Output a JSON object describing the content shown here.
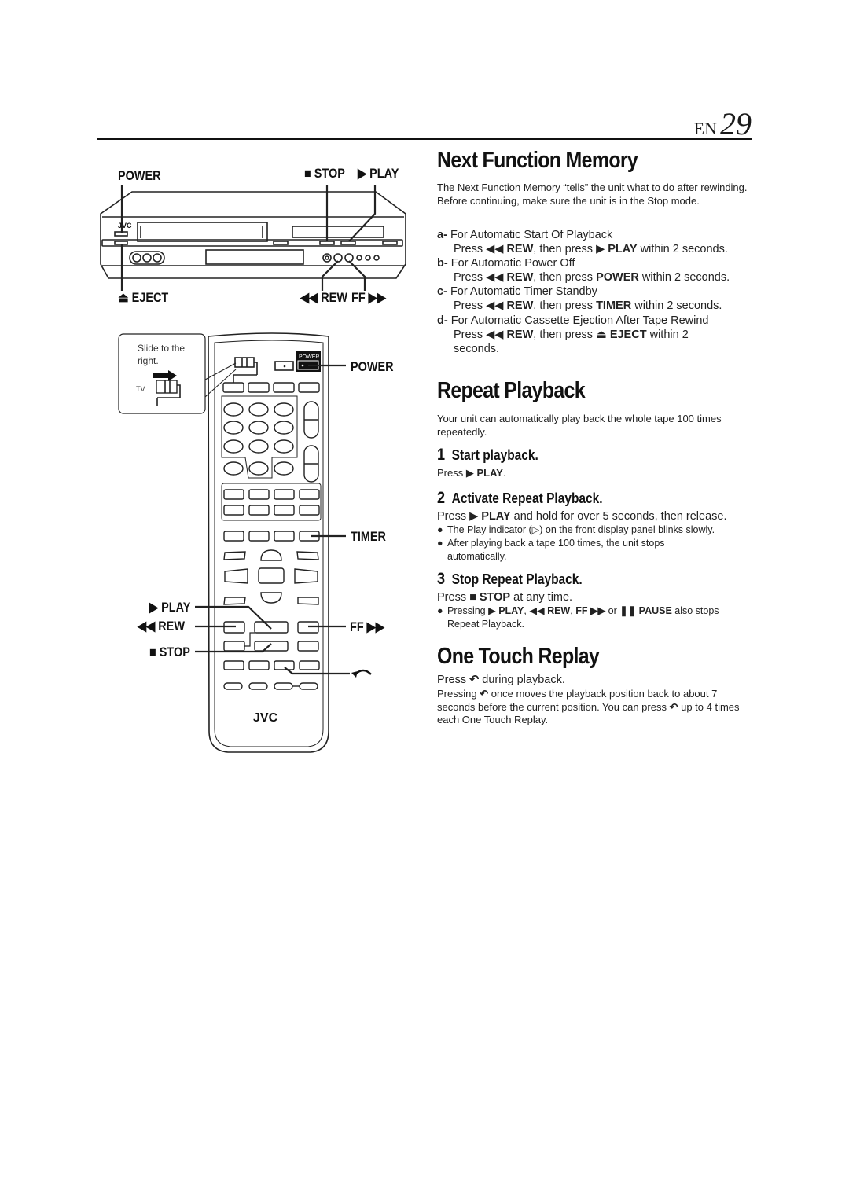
{
  "header": {
    "lang": "EN",
    "page_number": "29"
  },
  "illustration": {
    "vcr": {
      "brand": "JVC",
      "labels": {
        "power": "POWER",
        "stop": "STOP",
        "play": "PLAY",
        "eject": "EJECT",
        "rew": "REW",
        "ff": "FF"
      }
    },
    "remote": {
      "callout_text": "Slide to the right.",
      "callout_line1": "Slide to the",
      "callout_line2": "right.",
      "switch_label": "TV",
      "power_key_label": "POWER",
      "brand": "JVC",
      "labels": {
        "power": "POWER",
        "timer": "TIMER",
        "play": "PLAY",
        "rew": "REW",
        "ff": "FF",
        "stop": "STOP"
      }
    }
  },
  "sections": {
    "next_function": {
      "title": "Next Function Memory",
      "intro": "The Next Function Memory “tells” the unit what to do after rewinding. Before continuing, make sure the unit is in the Stop mode.",
      "items": [
        {
          "letter": "a-",
          "title": "For Automatic Start Of Playback",
          "pre": "Press ◀◀ ",
          "key1": "REW",
          "mid": ", then press ▶ ",
          "key2": "PLAY",
          "post": " within 2 seconds."
        },
        {
          "letter": "b-",
          "title": "For Automatic Power Off",
          "pre": "Press ◀◀ ",
          "key1": "REW",
          "mid": ", then press ",
          "key2": "POWER",
          "post": " within 2 seconds."
        },
        {
          "letter": "c-",
          "title": "For Automatic Timer Standby",
          "pre": "Press ◀◀ ",
          "key1": "REW",
          "mid": ", then press ",
          "key2": "TIMER",
          "post": " within 2 seconds."
        },
        {
          "letter": "d-",
          "title": "For Automatic Cassette Ejection After Tape Rewind",
          "pre": "Press ◀◀ ",
          "key1": "REW",
          "mid": ", then press ⏏ ",
          "key2": "EJECT",
          "post": " within 2",
          "post2": "seconds."
        }
      ]
    },
    "repeat": {
      "title": "Repeat Playback",
      "intro": "Your unit can automatically play back the whole tape 100 times repeatedly.",
      "steps": [
        {
          "number": "1",
          "title": "Start playback.",
          "pre": "Press ▶ ",
          "key": "PLAY",
          "post": "."
        },
        {
          "number": "2",
          "title": "Activate Repeat Playback.",
          "pre": "Press ▶ ",
          "key": "PLAY",
          "post": " and hold for over 5 seconds, then release.",
          "bullets": [
            "The Play indicator (▷) on the front display panel blinks slowly.",
            "After playing back a tape 100 times, the unit stops automatically."
          ]
        },
        {
          "number": "3",
          "title": "Stop Repeat Playback.",
          "pre": "Press ■ ",
          "key": "STOP",
          "post": " at any time.",
          "bullet_parts": [
            "Pressing ▶ ",
            "PLAY",
            ", ◀◀ ",
            "REW",
            ", ",
            "FF ▶▶",
            " or ",
            "❚❚ PAUSE",
            " also stops Repeat Playback."
          ]
        }
      ]
    },
    "replay": {
      "title": "One Touch Replay",
      "line1_pre": "Press ",
      "line1_post": " during playback.",
      "desc_pre": "Pressing ",
      "desc_mid": " once moves the playback position back to about 7 seconds before the current position. You can press ",
      "desc_post": " up to 4 times each One Touch Replay."
    }
  }
}
